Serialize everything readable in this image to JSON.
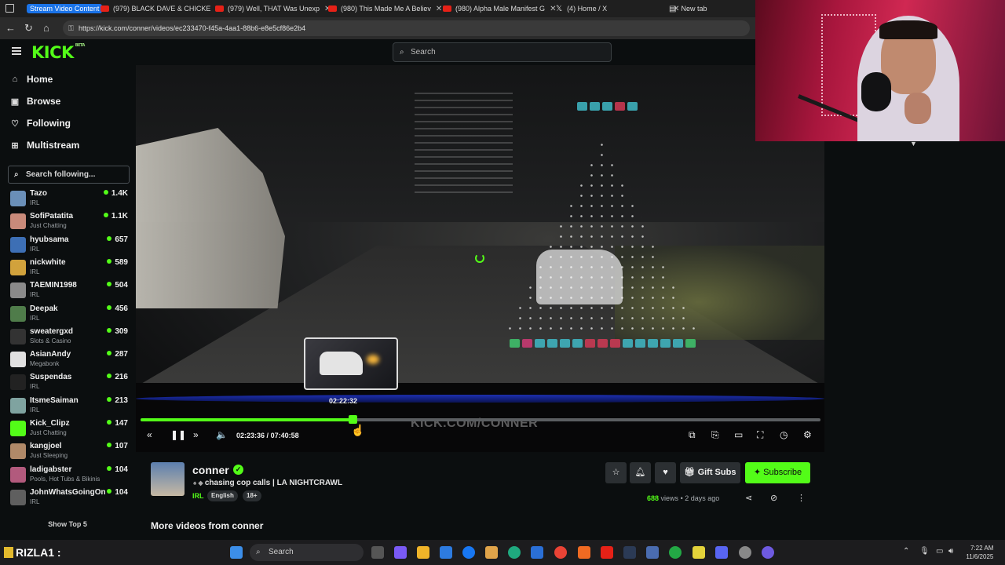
{
  "browser": {
    "tabs": [
      {
        "label": "Stream Video Content",
        "color": "#1a73e8",
        "active": true
      },
      {
        "label": "(979) BLACK DAVE & CHICKE",
        "color": "#e62117"
      },
      {
        "label": "(979) Well, THAT Was Unexp",
        "color": "#e62117"
      },
      {
        "label": "(980) This Made Me A Believ",
        "color": "#e62117"
      },
      {
        "label": "(980) Alpha Male Manifest G",
        "color": "#e62117"
      },
      {
        "label": "(4) Home / X",
        "color": "#ffffff"
      },
      {
        "label": "New tab",
        "color": "#9aa0a6"
      }
    ],
    "url": "https://kick.com/conner/videos/ec233470-f45a-4aa1-88b6-e8e5cf86e2b4"
  },
  "site": {
    "logo": "KICK",
    "logo_sup": "BETA",
    "search_placeholder": "Search"
  },
  "sidebar": {
    "nav": [
      {
        "label": "Home",
        "icon": "home-icon"
      },
      {
        "label": "Browse",
        "icon": "browse-icon"
      },
      {
        "label": "Following",
        "icon": "heart-icon"
      },
      {
        "label": "Multistream",
        "icon": "grid-icon"
      }
    ],
    "follow_search_placeholder": "Search following...",
    "channels": [
      {
        "name": "Tazo",
        "category": "IRL",
        "viewers": "1.4K",
        "color": "#6a8fb8"
      },
      {
        "name": "SofiPatatita",
        "category": "Just Chatting",
        "viewers": "1.1K",
        "color": "#c98a7a"
      },
      {
        "name": "hyubsama",
        "category": "IRL",
        "viewers": "657",
        "color": "#3d6fb5"
      },
      {
        "name": "nickwhite",
        "category": "IRL",
        "viewers": "589",
        "color": "#d1a23c"
      },
      {
        "name": "TAEMIN1998",
        "category": "IRL",
        "viewers": "504",
        "color": "#8a8a8a"
      },
      {
        "name": "Deepak",
        "category": "IRL",
        "viewers": "456",
        "color": "#4f7c4a"
      },
      {
        "name": "sweatergxd",
        "category": "Slots & Casino",
        "viewers": "309",
        "color": "#333333"
      },
      {
        "name": "AsianAndy",
        "category": "Megabonk",
        "viewers": "287",
        "color": "#e0e0e0"
      },
      {
        "name": "Suspendas",
        "category": "IRL",
        "viewers": "216",
        "color": "#222222"
      },
      {
        "name": "ItsmeSaiman",
        "category": "IRL",
        "viewers": "213",
        "color": "#7fa3a0"
      },
      {
        "name": "Kick_Clipz",
        "category": "Just Chatting",
        "viewers": "147",
        "color": "#53fc18"
      },
      {
        "name": "kangjoel",
        "category": "Just Sleeping",
        "viewers": "107",
        "color": "#b08968"
      },
      {
        "name": "ladigabster",
        "category": "Pools, Hot Tubs & Bikinis",
        "viewers": "104",
        "color": "#b25a7d"
      },
      {
        "name": "JohnWhatsGoingOn",
        "category": "IRL",
        "viewers": "104",
        "color": "#5f5f5f"
      }
    ],
    "show_more": "Show Top 5"
  },
  "player": {
    "hover_time": "02:22:32",
    "current_time": "02:23:36",
    "duration": "07:40:58",
    "time_separator": "/",
    "progress": 0.3118,
    "watermark": "KICK.COM/CONNER"
  },
  "channel": {
    "name": "conner",
    "video_title": "chasing cop calls | LA NIGHTCRAWL",
    "category": "IRL",
    "tags": [
      "English",
      "18+"
    ],
    "gift_label": "Gift Subs",
    "subscribe_label": "Subscribe",
    "views_count": "688",
    "views_word": "views",
    "dot": "•",
    "date": "2 days ago",
    "more_videos": "More videos from conner"
  },
  "taskbar": {
    "user": "RIZLA1 :",
    "search": "Search",
    "time": "7:22 AM",
    "date": "11/6/2025"
  }
}
